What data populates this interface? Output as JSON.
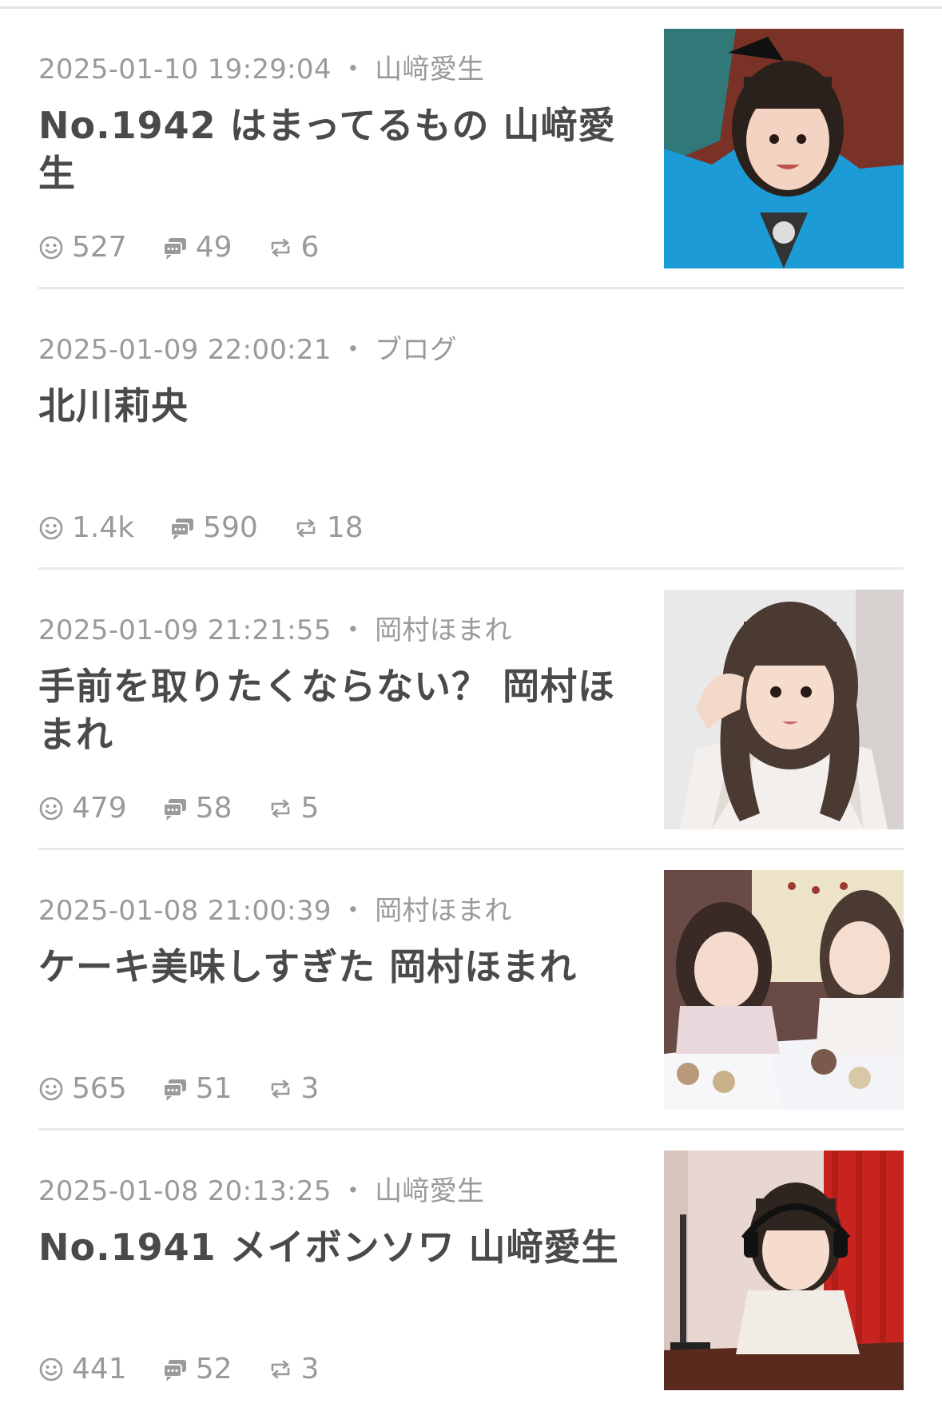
{
  "posts": [
    {
      "date": "2025-01-10 19:29:04",
      "author": "山﨑愛生",
      "title": "No.1942 はまってるもの 山﨑愛生",
      "likes": "527",
      "comments": "49",
      "reposts": "6",
      "has_thumbnail": true,
      "thumbnail_desc": "photo"
    },
    {
      "date": "2025-01-09 22:00:21",
      "author": "ブログ",
      "title": "北川莉央",
      "likes": "1.4k",
      "comments": "590",
      "reposts": "18",
      "has_thumbnail": false
    },
    {
      "date": "2025-01-09 21:21:55",
      "author": "岡村ほまれ",
      "title": "手前を取りたくならない？ 岡村ほまれ",
      "likes": "479",
      "comments": "58",
      "reposts": "5",
      "has_thumbnail": true
    },
    {
      "date": "2025-01-08 21:00:39",
      "author": "岡村ほまれ",
      "title": "ケーキ美味しすぎた 岡村ほまれ",
      "likes": "565",
      "comments": "51",
      "reposts": "3",
      "has_thumbnail": true
    },
    {
      "date": "2025-01-08 20:13:25",
      "author": "山﨑愛生",
      "title": "No.1941 メイボンソワ 山﨑愛生",
      "likes": "441",
      "comments": "52",
      "reposts": "3",
      "has_thumbnail": true
    }
  ],
  "meta_separator": "・",
  "icons": {
    "likes": "smile-icon",
    "comments": "speech-bubble-icon",
    "reposts": "repost-icon"
  },
  "colors": {
    "meta_text": "#9a9a9a",
    "title_text": "#4a4a4a",
    "divider": "#e8e8e8"
  }
}
